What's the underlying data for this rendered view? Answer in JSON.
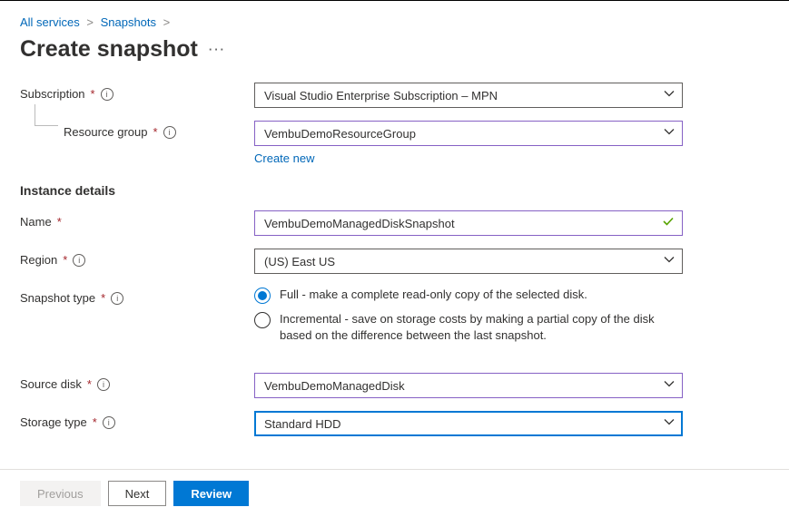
{
  "breadcrumb": {
    "item1": "All services",
    "item2": "Snapshots"
  },
  "page_title": "Create snapshot",
  "labels": {
    "subscription": "Subscription",
    "resource_group": "Resource group",
    "instance_details": "Instance details",
    "name": "Name",
    "region": "Region",
    "snapshot_type": "Snapshot type",
    "source_disk": "Source disk",
    "storage_type": "Storage type"
  },
  "values": {
    "subscription": "Visual Studio Enterprise Subscription – MPN",
    "resource_group": "VembuDemoResourceGroup",
    "name": "VembuDemoManagedDiskSnapshot",
    "region": "(US) East US",
    "source_disk": "VembuDemoManagedDisk",
    "storage_type": "Standard HDD"
  },
  "links": {
    "create_new": "Create new"
  },
  "snapshot_type": {
    "full": "Full - make a complete read-only copy of the selected disk.",
    "incremental": "Incremental - save on storage costs by making a partial copy of the disk based on the difference between the last snapshot."
  },
  "buttons": {
    "previous": "Previous",
    "next": "Next",
    "review": "Review"
  },
  "info_glyph": "i"
}
